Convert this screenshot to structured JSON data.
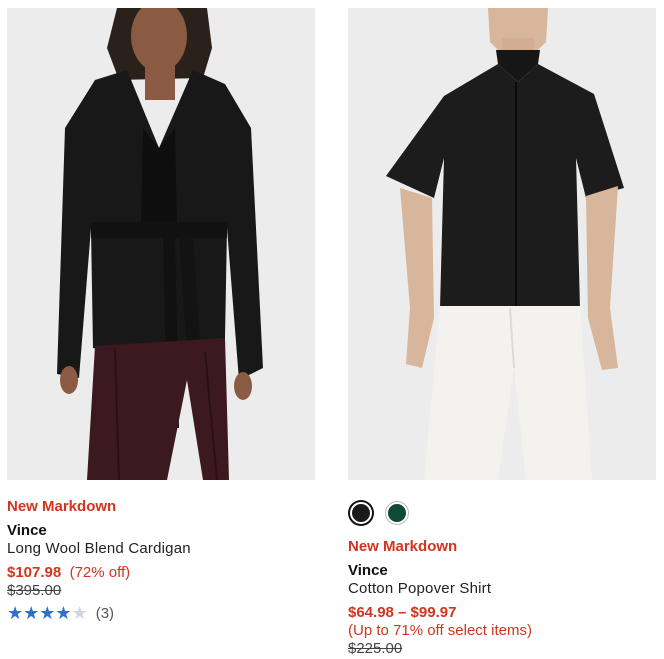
{
  "products": [
    {
      "badge": "New Markdown",
      "brand": "Vince",
      "name": "Long Wool Blend Cardigan",
      "sale_price": "$107.98",
      "discount": "(72% off)",
      "original_price": "$395.00",
      "rating": {
        "stars": 4,
        "max": 5,
        "count": "(3)"
      },
      "image_alt": "model wearing black wrap cardigan with burgundy pants"
    },
    {
      "badge": "New Markdown",
      "brand": "Vince",
      "name": "Cotton Popover Shirt",
      "sale_price": "$64.98 – $99.97",
      "discount": "(Up to 71% off select items)",
      "original_price": "$225.00",
      "swatches": [
        {
          "name": "black",
          "color": "#1a1a1a",
          "selected": true
        },
        {
          "name": "green",
          "color": "#0f4a33",
          "selected": false
        }
      ],
      "image_alt": "model wearing black short-sleeve popover shirt with white pants"
    }
  ],
  "colors": {
    "sale_red": "#d2341f",
    "star_blue": "#2f6fd4"
  }
}
